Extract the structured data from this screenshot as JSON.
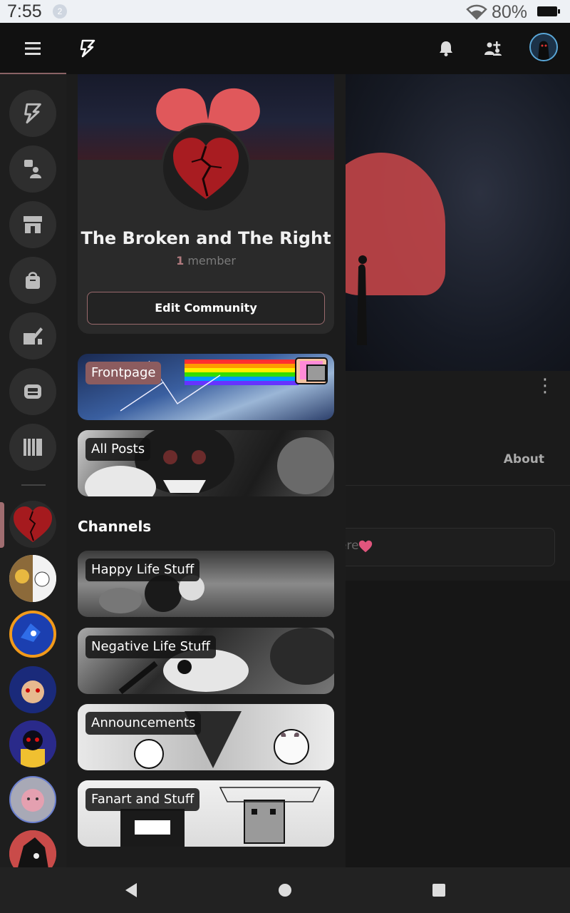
{
  "status_bar": {
    "time": "7:55",
    "notification_count": "2",
    "battery_percent": "80%"
  },
  "top_bar": {
    "menu_icon": "hamburger-icon",
    "logo_icon": "lightning-logo-icon",
    "bell_icon": "bell-icon",
    "people_icon": "people-add-icon"
  },
  "rail": {
    "items": [
      {
        "icon": "lightning-icon"
      },
      {
        "icon": "chat-person-icon"
      },
      {
        "icon": "store-icon"
      },
      {
        "icon": "bag-icon"
      },
      {
        "icon": "edit-brush-icon"
      },
      {
        "icon": "robot-icon"
      },
      {
        "icon": "library-icon"
      }
    ]
  },
  "community_card": {
    "title": "The Broken and The Right",
    "member_count": "1",
    "member_label": "member",
    "edit_button": "Edit Community"
  },
  "tiles": {
    "frontpage": "Frontpage",
    "all_posts": "All Posts"
  },
  "channels": {
    "header": "Channels",
    "items": [
      "Happy Life Stuff",
      "Negative Life Stuff",
      "Announcements",
      "Fanart and Stuff"
    ]
  },
  "background_page": {
    "about_tab": "About",
    "compose_placeholder_fragment": "ere"
  },
  "colors": {
    "accent": "#9a6a6d",
    "background": "#1c1c1c",
    "card": "#2a2a2a"
  }
}
